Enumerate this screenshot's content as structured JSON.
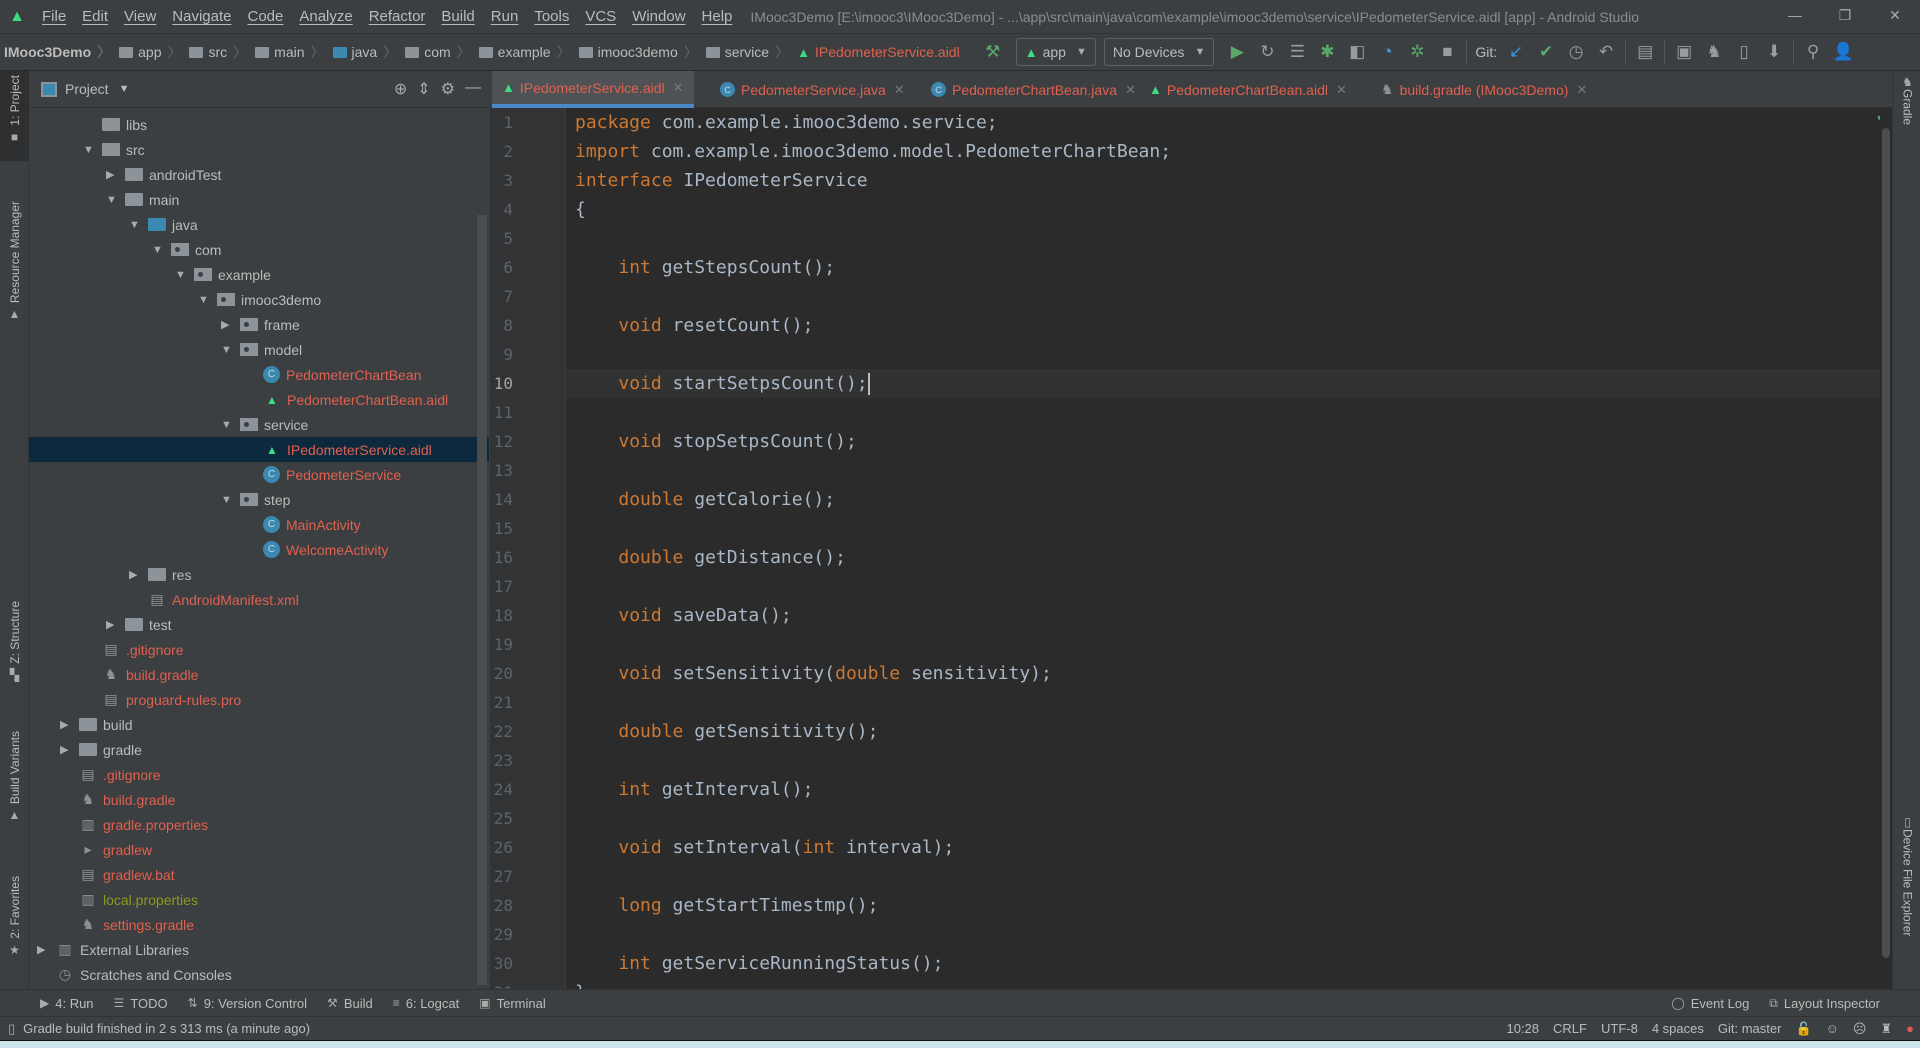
{
  "window": {
    "title": "IMooc3Demo [E:\\imooc3\\IMooc3Demo] - ...\\app\\src\\main\\java\\com\\example\\imooc3demo\\service\\IPedometerService.aidl [app] - Android Studio",
    "minimize": "—",
    "restore": "❐",
    "close": "✕"
  },
  "menu": [
    "File",
    "Edit",
    "View",
    "Navigate",
    "Code",
    "Analyze",
    "Refactor",
    "Build",
    "Run",
    "Tools",
    "VCS",
    "Window",
    "Help"
  ],
  "breadcrumb": [
    "IMooc3Demo",
    "app",
    "src",
    "main",
    "java",
    "com",
    "example",
    "imooc3demo",
    "service",
    "IPedometerService.aidl"
  ],
  "toolbar": {
    "config": "app",
    "device": "No Devices",
    "git_label": "Git:"
  },
  "left_stripe": [
    "1: Project",
    "Resource Manager",
    "Z: Structure",
    "Build Variants",
    "2: Favorites"
  ],
  "right_stripe": [
    "Gradle",
    "Device File Explorer"
  ],
  "project_panel": {
    "title": "Project",
    "tree": [
      {
        "label": "libs",
        "level": 2,
        "icon": "folder",
        "state": "none"
      },
      {
        "label": "src",
        "level": 2,
        "icon": "folder",
        "state": "open"
      },
      {
        "label": "androidTest",
        "level": 3,
        "icon": "folder",
        "state": "closed"
      },
      {
        "label": "main",
        "level": 3,
        "icon": "folder",
        "state": "open"
      },
      {
        "label": "java",
        "level": 4,
        "icon": "folder-blue",
        "state": "open"
      },
      {
        "label": "com",
        "level": 5,
        "icon": "package",
        "state": "open"
      },
      {
        "label": "example",
        "level": 6,
        "icon": "package",
        "state": "open"
      },
      {
        "label": "imooc3demo",
        "level": 7,
        "icon": "package",
        "state": "open"
      },
      {
        "label": "frame",
        "level": 8,
        "icon": "package",
        "state": "closed"
      },
      {
        "label": "model",
        "level": 8,
        "icon": "package",
        "state": "open"
      },
      {
        "label": "PedometerChartBean",
        "level": 9,
        "icon": "class",
        "state": "none",
        "color": "red"
      },
      {
        "label": "PedometerChartBean.aidl",
        "level": 9,
        "icon": "android",
        "state": "none",
        "color": "red"
      },
      {
        "label": "service",
        "level": 8,
        "icon": "package",
        "state": "open"
      },
      {
        "label": "IPedometerService.aidl",
        "level": 9,
        "icon": "android",
        "state": "none",
        "color": "red",
        "selected": true
      },
      {
        "label": "PedometerService",
        "level": 9,
        "icon": "class",
        "state": "none",
        "color": "red"
      },
      {
        "label": "step",
        "level": 8,
        "icon": "package",
        "state": "open"
      },
      {
        "label": "MainActivity",
        "level": 9,
        "icon": "class",
        "state": "none",
        "color": "red"
      },
      {
        "label": "WelcomeActivity",
        "level": 9,
        "icon": "class",
        "state": "none",
        "color": "red"
      },
      {
        "label": "res",
        "level": 4,
        "icon": "folder",
        "state": "closed"
      },
      {
        "label": "AndroidManifest.xml",
        "level": 4,
        "icon": "manifest",
        "state": "none",
        "color": "red"
      },
      {
        "label": "test",
        "level": 3,
        "icon": "folder",
        "state": "closed"
      },
      {
        "label": ".gitignore",
        "level": 2,
        "icon": "file",
        "state": "none",
        "color": "red"
      },
      {
        "label": "build.gradle",
        "level": 2,
        "icon": "gradle",
        "state": "none",
        "color": "red"
      },
      {
        "label": "proguard-rules.pro",
        "level": 2,
        "icon": "file",
        "state": "none",
        "color": "red"
      },
      {
        "label": "build",
        "level": 1,
        "icon": "folder",
        "state": "closed"
      },
      {
        "label": "gradle",
        "level": 1,
        "icon": "folder",
        "state": "closed"
      },
      {
        "label": ".gitignore",
        "level": 1,
        "icon": "file",
        "state": "none",
        "color": "red"
      },
      {
        "label": "build.gradle",
        "level": 1,
        "icon": "gradle",
        "state": "none",
        "color": "red"
      },
      {
        "label": "gradle.properties",
        "level": 1,
        "icon": "properties",
        "state": "none",
        "color": "red"
      },
      {
        "label": "gradlew",
        "level": 1,
        "icon": "terminal",
        "state": "none",
        "color": "red"
      },
      {
        "label": "gradlew.bat",
        "level": 1,
        "icon": "file",
        "state": "none",
        "color": "red"
      },
      {
        "label": "local.properties",
        "level": 1,
        "icon": "properties",
        "state": "none",
        "color": "olive"
      },
      {
        "label": "settings.gradle",
        "level": 1,
        "icon": "gradle",
        "state": "none",
        "color": "red"
      },
      {
        "label": "External Libraries",
        "level": 0,
        "icon": "libraries",
        "state": "closed"
      },
      {
        "label": "Scratches and Consoles",
        "level": 0,
        "icon": "scratches",
        "state": "none"
      }
    ]
  },
  "tabs": [
    {
      "label": "IPedometerService.aidl",
      "icon": "android",
      "active": true
    },
    {
      "label": "PedometerService.java",
      "icon": "class"
    },
    {
      "label": "PedometerChartBean.java",
      "icon": "class"
    },
    {
      "label": "PedometerChartBean.aidl",
      "icon": "android"
    },
    {
      "label": "build.gradle (IMooc3Demo)",
      "icon": "gradle"
    }
  ],
  "editor": {
    "current_line": 10,
    "keywords": [
      "package",
      "import",
      "interface",
      "int",
      "void",
      "double",
      "long"
    ],
    "lines": [
      "package com.example.imooc3demo.service;",
      "import com.example.imooc3demo.model.PedometerChartBean;",
      "interface IPedometerService",
      "{",
      "",
      "    int getStepsCount();",
      "",
      "    void resetCount();",
      "",
      "    void startSetpsCount();",
      "",
      "    void stopSetpsCount();",
      "",
      "    double getCalorie();",
      "",
      "    double getDistance();",
      "",
      "    void saveData();",
      "",
      "    void setSensitivity(double sensitivity);",
      "",
      "    double getSensitivity();",
      "",
      "    int getInterval();",
      "",
      "    void setInterval(int interval);",
      "",
      "    long getStartTimestmp();",
      "",
      "    int getServiceRunningStatus();",
      "}"
    ]
  },
  "tool_windows": [
    {
      "label": "4: Run",
      "icon": "run-icon",
      "glyph": "▶"
    },
    {
      "label": "TODO",
      "icon": "todo-icon",
      "glyph": "☰"
    },
    {
      "label": "9: Version Control",
      "icon": "vcs-icon",
      "glyph": "⇅"
    },
    {
      "label": "Build",
      "icon": "hammer-icon",
      "glyph": "⚒"
    },
    {
      "label": "6: Logcat",
      "icon": "logcat-icon",
      "glyph": "≡"
    },
    {
      "label": "Terminal",
      "icon": "terminal-icon",
      "glyph": "▣"
    }
  ],
  "tool_windows_right": [
    {
      "label": "Event Log",
      "icon": "event-log-icon",
      "glyph": "◯"
    },
    {
      "label": "Layout Inspector",
      "icon": "layout-inspector-icon",
      "glyph": "⧉"
    }
  ],
  "status": {
    "message": "Gradle build finished in 2 s 313 ms (a minute ago)",
    "position": "10:28",
    "line_sep": "CRLF",
    "encoding": "UTF-8",
    "indent": "4 spaces",
    "git": "Git: master"
  },
  "colors": {
    "keyword": "#cc7832",
    "text": "#a9b7c6",
    "modified_file": "#e0604f",
    "selection": "#0d293e",
    "accent": "#4a88c7"
  }
}
